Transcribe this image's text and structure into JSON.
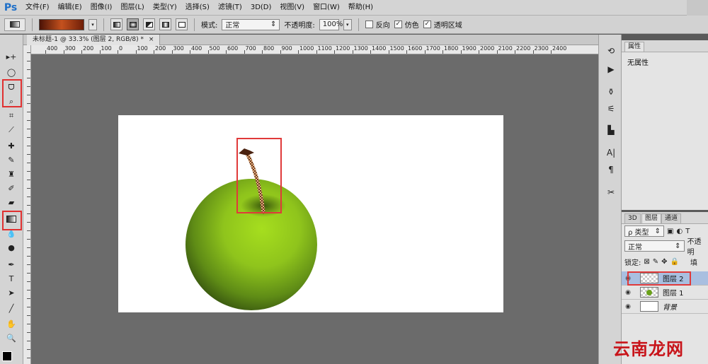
{
  "app": {
    "logo": "Ps"
  },
  "menu": [
    "文件(F)",
    "编辑(E)",
    "图像(I)",
    "图层(L)",
    "类型(Y)",
    "选择(S)",
    "滤镜(T)",
    "3D(D)",
    "视图(V)",
    "窗口(W)",
    "帮助(H)"
  ],
  "options": {
    "mode_label": "模式:",
    "mode_value": "正常",
    "opacity_label": "不透明度:",
    "opacity_value": "100%",
    "reverse_label": "反向",
    "dither_label": "仿色",
    "transparency_label": "透明区域",
    "reverse_checked": false,
    "dither_checked": true,
    "transparency_checked": true
  },
  "document": {
    "tab_title": "未标题-1 @ 33.3% (图层 2, RGB/8) *",
    "close": "×",
    "ruler_top": [
      "400",
      "300",
      "200",
      "100",
      "0",
      "100",
      "200",
      "300",
      "400",
      "500",
      "600",
      "700",
      "800",
      "900",
      "1000",
      "1100",
      "1200",
      "1300",
      "1400",
      "1500",
      "1600",
      "1700",
      "1800",
      "1900",
      "2000",
      "2100",
      "2200",
      "2300",
      "2400"
    ]
  },
  "properties": {
    "tab": "属性",
    "text": "无属性"
  },
  "layers": {
    "tabs": [
      "3D",
      "图层",
      "通道"
    ],
    "filter_label": "ρ 类型",
    "blend_mode": "正常",
    "opacity_short": "不透明",
    "lock_label": "锁定:",
    "fill_short": "填",
    "items": [
      {
        "name": "图层 2",
        "selected": true
      },
      {
        "name": "图层 1",
        "selected": false
      },
      {
        "name": "背景",
        "selected": false
      }
    ]
  },
  "watermark": "云南龙网",
  "colors": {
    "highlight": "#e03a3a",
    "apple_green": "#8fc41c",
    "stem": "#6a3a1e"
  }
}
